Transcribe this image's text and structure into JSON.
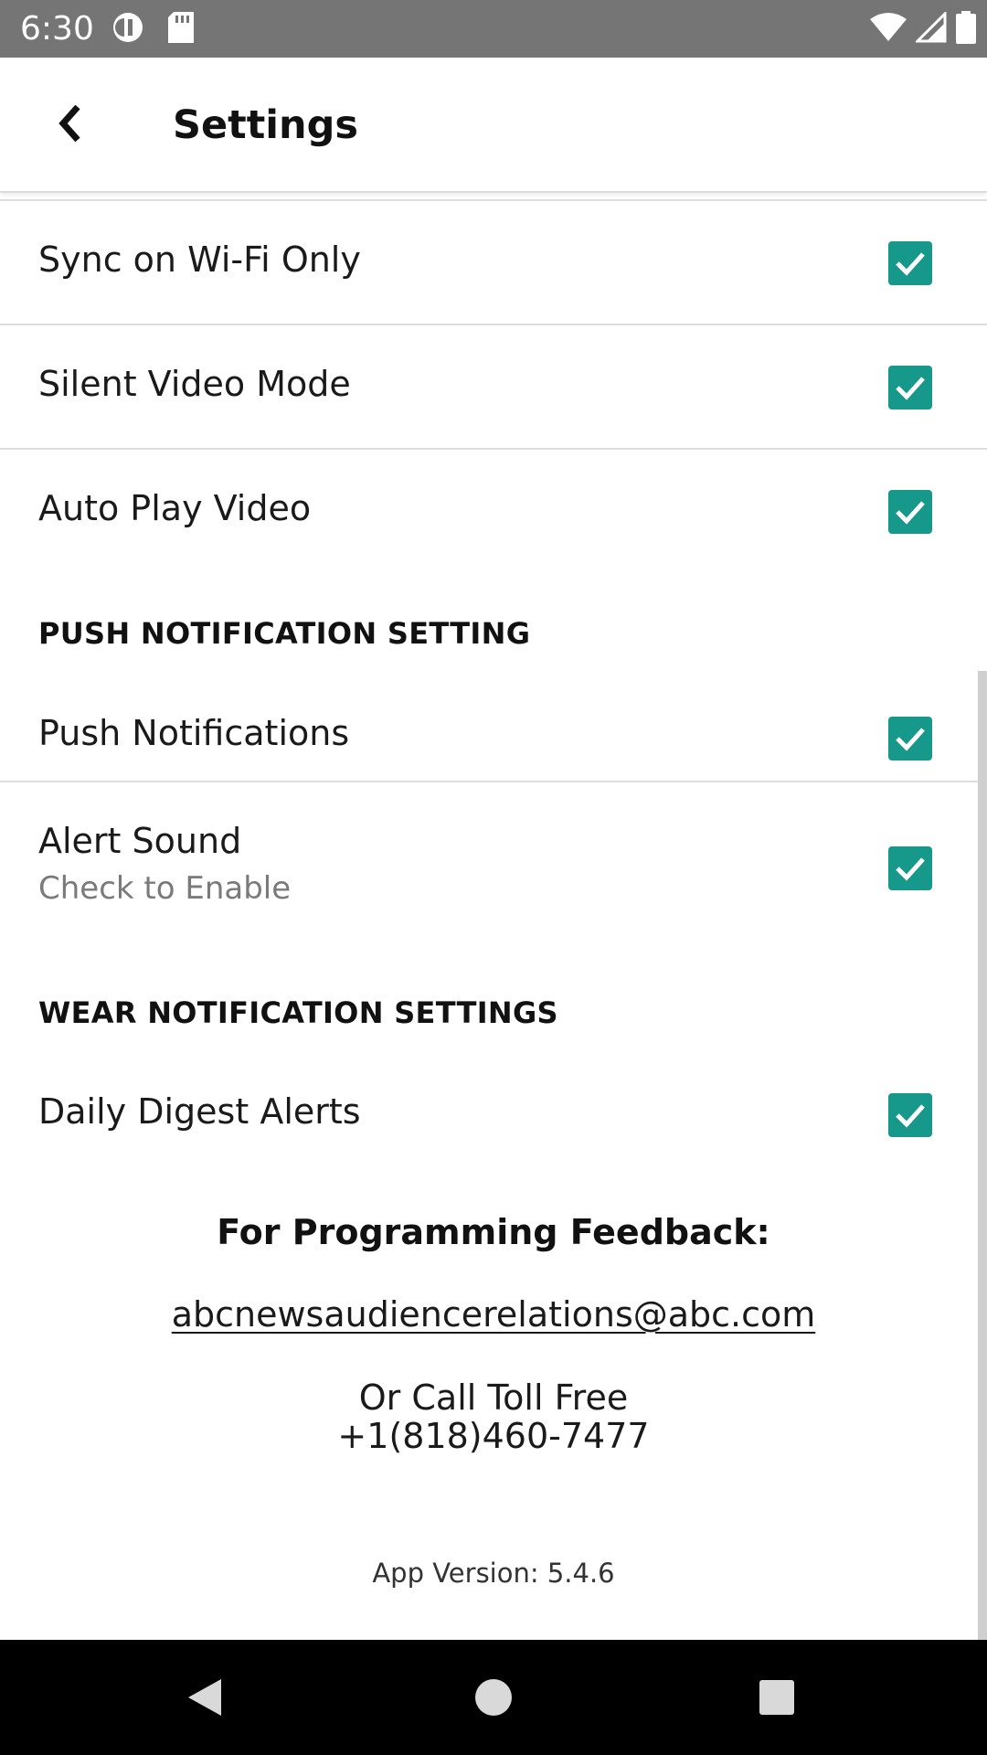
{
  "status_bar": {
    "time": "6:30",
    "left_icons": [
      "data-saver-icon",
      "sd-card-icon"
    ],
    "right_icons": [
      "wifi-icon",
      "cell-signal-icon",
      "battery-icon"
    ]
  },
  "app_bar": {
    "back_icon": "chevron-left-icon",
    "title": "Settings"
  },
  "settings": [
    {
      "label": "Sync on Wi-Fi Only",
      "checked": true
    },
    {
      "label": "Silent Video Mode",
      "checked": true
    },
    {
      "label": "Auto Play Video",
      "checked": true
    }
  ],
  "push_section": {
    "header": "PUSH NOTIFICATION SETTING",
    "items": [
      {
        "label": "Push Notifications",
        "checked": true
      },
      {
        "label": "Alert Sound",
        "sublabel": "Check to Enable",
        "checked": true
      }
    ]
  },
  "wear_section": {
    "header": "WEAR NOTIFICATION SETTINGS",
    "items": [
      {
        "label": "Daily Digest Alerts",
        "checked": true
      }
    ]
  },
  "feedback": {
    "title": "For Programming Feedback:",
    "email": "abcnewsaudiencerelations@abc.com",
    "call_label": "Or Call Toll Free",
    "phone": "+1(818)460-7477"
  },
  "app_version": "App Version: 5.4.6",
  "colors": {
    "checkbox": "#16998a",
    "status_bar": "#757575",
    "nav_bar": "#000000"
  },
  "nav_bar": {
    "buttons": [
      "back-triangle-icon",
      "home-circle-icon",
      "recents-square-icon"
    ]
  }
}
